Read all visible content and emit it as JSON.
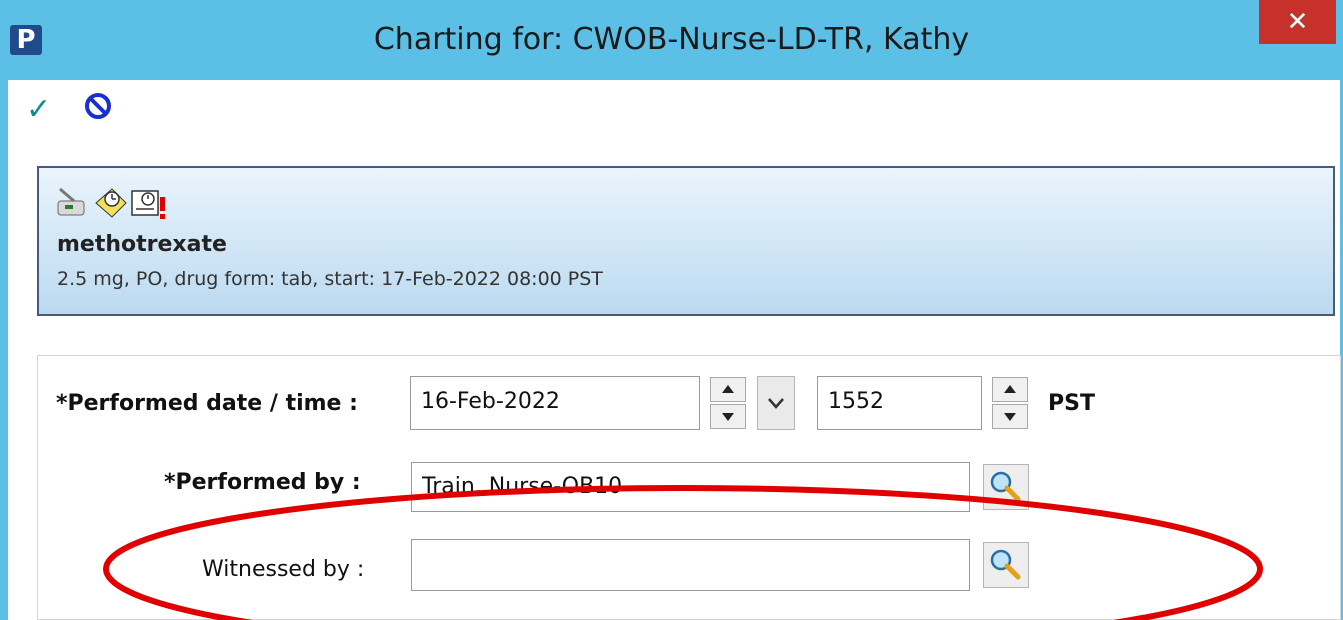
{
  "window": {
    "title": "Charting for: CWOB-Nurse-LD-TR, Kathy",
    "app_icon_letter": "P",
    "close_symbol": "✕"
  },
  "toolbar": {
    "sign_icon": "check-icon",
    "sign_symbol": "✓",
    "cancel_icon": "prohibited-icon"
  },
  "order": {
    "name": "methotrexate",
    "details": "2.5 mg, PO, drug form: tab, start: 17-Feb-2022 08:00 PST",
    "icons": [
      "mortar-pestle-icon",
      "clock-note-icon",
      "review-required-icon"
    ]
  },
  "form": {
    "performed_datetime_label": "*Performed date / time :",
    "performed_date": "16-Feb-2022",
    "performed_time": "1552",
    "timezone": "PST",
    "performed_by_label": "*Performed by :",
    "performed_by_value": "Train, Nurse-OB10",
    "witnessed_by_label": "Witnessed by :",
    "witnessed_by_value": ""
  },
  "annotation": {
    "highlight_color": "#e00000",
    "highlight_target": "witnessed-by-row"
  },
  "colors": {
    "titlebar": "#5bbfe6",
    "close": "#c7302b",
    "check": "#0e8f88",
    "cancel": "#1a2fd0"
  }
}
